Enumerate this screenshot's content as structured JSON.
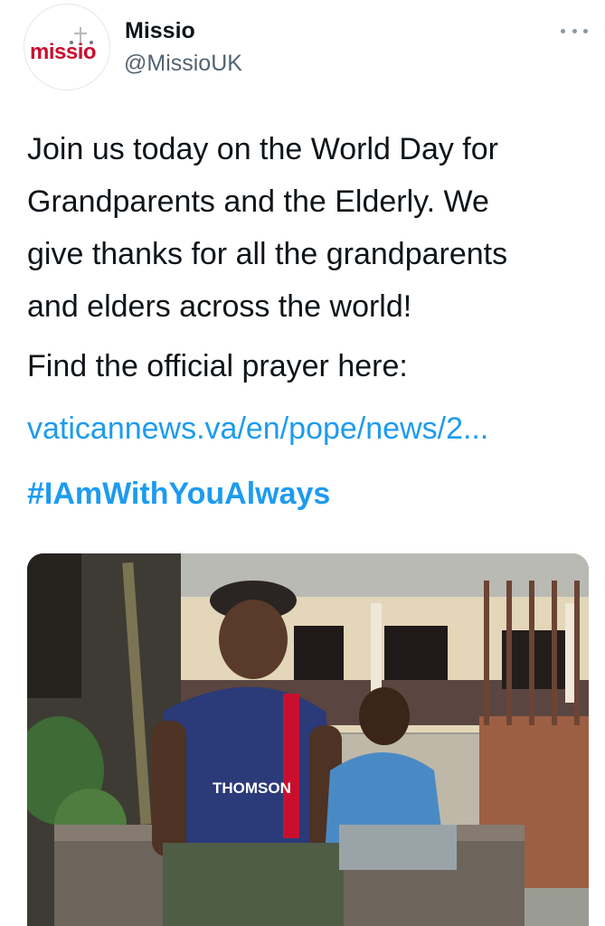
{
  "account": {
    "display_name": "Missio",
    "handle": "@MissioUK",
    "avatar_logo_text": "missio"
  },
  "header": {
    "more_icon": "more-horizontal-icon"
  },
  "tweet": {
    "text_lines": [
      "Join us today on the World Day for",
      "Grandparents and the Elderly. We",
      "give thanks for all the grandparents",
      "and elders across the world!"
    ],
    "prayer_line": "Find the official prayer here:",
    "link": "vaticannews.va/en/pope/news/2...",
    "hashtag": "#IAmWithYouAlways"
  },
  "photo": {
    "shirt_text": "THOMSON"
  },
  "colors": {
    "link_blue": "#1d9bf0",
    "text": "#0f1419",
    "secondary": "#536471",
    "brand_red": "#c8102e"
  }
}
